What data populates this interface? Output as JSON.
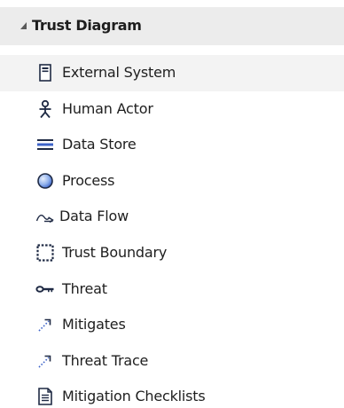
{
  "toolbox": {
    "group": {
      "title": "Trust Diagram",
      "expanded": true
    },
    "items": [
      {
        "label": "External System",
        "icon": "external-system-icon"
      },
      {
        "label": "Human Actor",
        "icon": "human-actor-icon"
      },
      {
        "label": "Data Store",
        "icon": "data-store-icon"
      },
      {
        "label": "Process",
        "icon": "process-icon"
      },
      {
        "label": "Data Flow",
        "icon": "data-flow-icon"
      },
      {
        "label": "Trust Boundary",
        "icon": "trust-boundary-icon"
      },
      {
        "label": "Threat",
        "icon": "threat-icon"
      },
      {
        "label": "Mitigates",
        "icon": "mitigates-icon"
      },
      {
        "label": "Threat Trace",
        "icon": "threat-trace-icon"
      },
      {
        "label": "Mitigation Checklists",
        "icon": "mitigation-checklists-icon"
      }
    ],
    "colors": {
      "header_bg": "#ececec",
      "selected_bg": "#f3f3f3",
      "text": "#1e1e1e",
      "icon_dark": "#1f2a44",
      "icon_blue": "#3c63c9"
    }
  }
}
